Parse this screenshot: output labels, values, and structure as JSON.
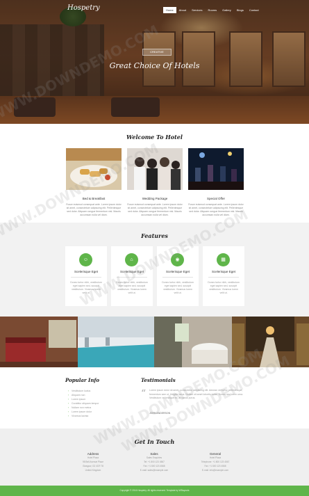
{
  "header": {
    "logo": "Hospetry",
    "nav": [
      "Home",
      "About",
      "Services",
      "Rooms",
      "Gallery",
      "Blogs",
      "Contact"
    ],
    "active_nav": "Home"
  },
  "hero": {
    "badge": "CREATIVE",
    "title": "Great Choice Of Hotels"
  },
  "welcome": {
    "title": "Welcome To Hotel",
    "cards": [
      {
        "caption": "Bed & Breakfast",
        "text": "Fusce euismod consequat ante. Lorem ipsum dolor sit amet, consectetuer adipiscing elit. Pellentesque sed dolor. Aliquam congue fermentum nisl. Mauris accumsan nulla vel diam."
      },
      {
        "caption": "Wedding Package",
        "text": "Fusce euismod consequat ante. Lorem ipsum dolor sit amet, consectetuer adipiscing elit. Pellentesque sed dolor. Aliquam congue fermentum nisl. Mauris accumsan nulla vel diam."
      },
      {
        "caption": "Special Offer",
        "text": "Fusce euismod consequat ante. Lorem ipsum dolor sit amet, consectetuer adipiscing elit. Pellentesque sed dolor. Aliquam congue fermentum nisl. Mauris accumsan nulla vel diam."
      }
    ]
  },
  "features": {
    "title": "Features",
    "accent": "#5fb54a",
    "cards": [
      {
        "icon": "user-icon",
        "glyph": "☺",
        "name": "Scelerisque Eget",
        "text": "Donec tortor nibh, vestibulum eget sapien sed, suscipit vestibulum. Vivamus lorem velit ut."
      },
      {
        "icon": "home-icon",
        "glyph": "⌂",
        "name": "Scelerisque Eget",
        "text": "Donec tortor nibh, vestibulum eget sapien sed, suscipit vestibulum. Vivamus lorem velit ut."
      },
      {
        "icon": "camera-icon",
        "glyph": "◉",
        "name": "Scelerisque Eget",
        "text": "Donec tortor nibh, vestibulum eget sapien sed, suscipit vestibulum. Vivamus lorem velit ut."
      },
      {
        "icon": "grid-icon",
        "glyph": "▦",
        "name": "Scelerisque Eget",
        "text": "Donec tortor nibh, vestibulum eget sapien sed, suscipit vestibulum. Vivamus lorem velit ut."
      }
    ]
  },
  "info": {
    "popular_title": "Popular Info",
    "popular_items": [
      "Vestibulum luctus",
      "Aliquam non",
      "Lorem ipsum",
      "Curabitur aliquam tempor",
      "Nullam non metus",
      "Lorem ipsum dolor",
      "Vivamus lacinia"
    ],
    "testimonials_title": "Testimonials",
    "testimonial_text": "Lorem ipsum dolor sit amet, consectetur adipiscing elit. Aenean vel tortor pellentesque, fermentum sem ut, fringilla lacus. Nullam sit amet lobortis tortor. Donec nec lorem urna. Vestibulum vel tristique ex, at varius purus.",
    "testimonial_author": "JOHN ANDERSON"
  },
  "contact": {
    "title": "Get In Touch",
    "columns": [
      {
        "head": "Address",
        "lines": [
          "Hotel Plaza",
          "98 Bell Avenue Place",
          "Glasgow, G2 4CR 78",
          "United Kingdom"
        ]
      },
      {
        "head": "Sales",
        "lines": [
          "Sales Enquiries",
          "Tel: +1 800 123 4567",
          "Fax: +1 800 123 4568",
          "E-mail: sales@example.com"
        ]
      },
      {
        "head": "General",
        "lines": [
          "Hotel Plaza",
          "Telephone: +1 800 123 4567",
          "Fax: +1 800 123 4568",
          "E-mail: info@example.com"
        ]
      }
    ]
  },
  "footer": {
    "text": "Copyright © 2016 Hospetry. All rights reserved. Template by W3layouts"
  },
  "watermark": "WWW.DOWNDEMO.COM"
}
